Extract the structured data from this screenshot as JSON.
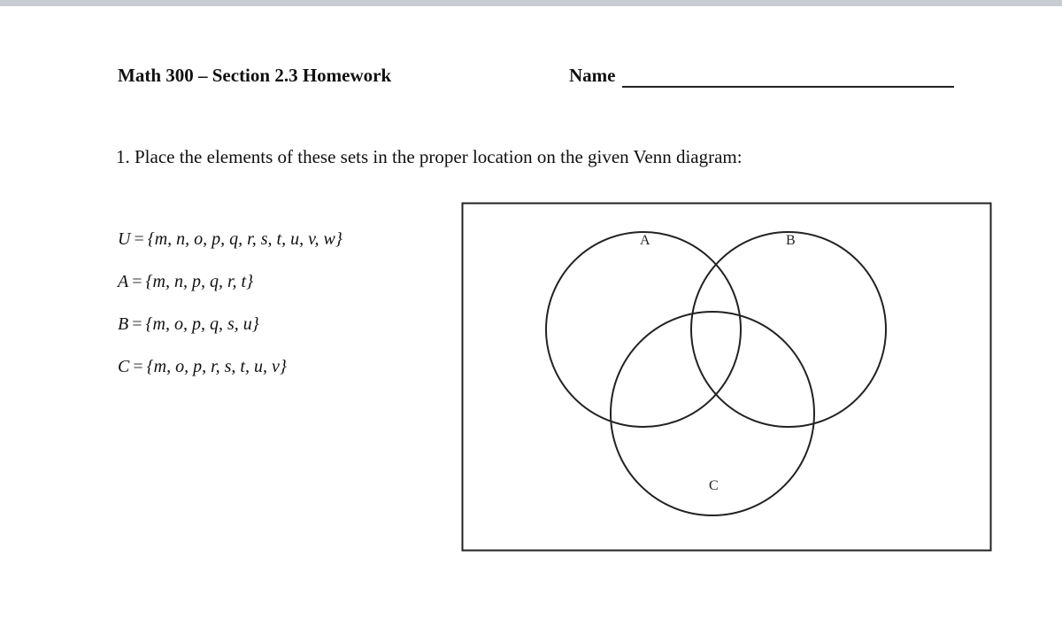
{
  "header": {
    "course_title": "Math 300 – Section 2.3 Homework",
    "name_label": "Name"
  },
  "question": {
    "text": "1. Place the elements of these sets in the proper location on the given Venn diagram:"
  },
  "sets": [
    {
      "name": "U",
      "eq": "=",
      "elements": "{m, n, o, p, q, r, s, t, u, v, w}"
    },
    {
      "name": "A",
      "eq": "=",
      "elements": "{m, n, p, q, r, t}"
    },
    {
      "name": "B",
      "eq": "=",
      "elements": "{m, o, p, q, s, u}"
    },
    {
      "name": "C",
      "eq": "=",
      "elements": "{m, o, p, r, s, t, u, v}"
    }
  ],
  "venn": {
    "labels": {
      "a": "A",
      "b": "B",
      "c": "C"
    }
  }
}
